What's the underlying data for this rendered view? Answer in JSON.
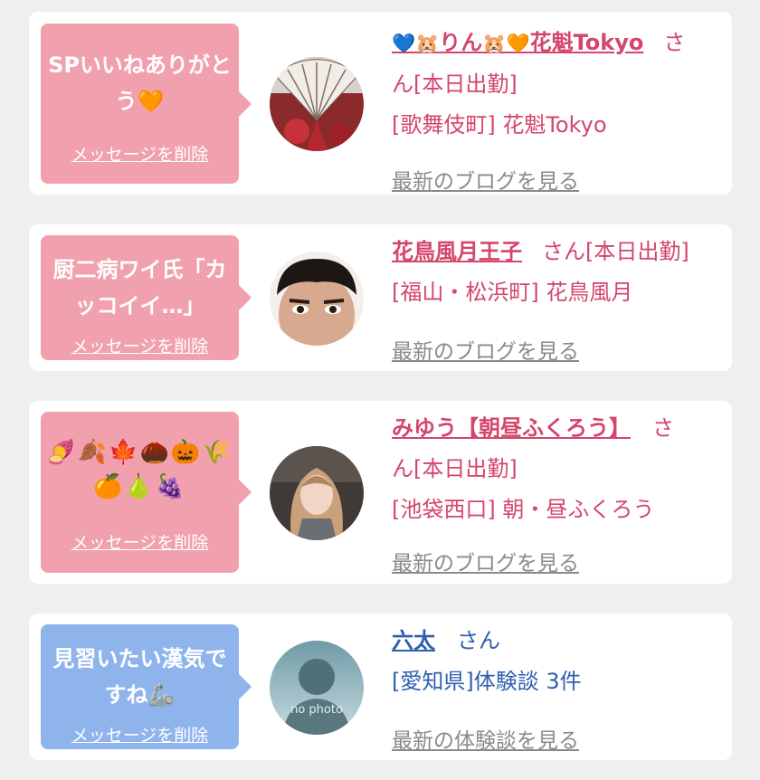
{
  "colors": {
    "background": "#efefef",
    "card": "#ffffff",
    "pink_bubble": "#f0a1ad",
    "blue_bubble": "#8fb4ec",
    "pink_text": "#d4466b",
    "blue_text": "#2f5fae",
    "link_gray": "#8a8a8a"
  },
  "delete_label": "メッセージを削除",
  "san": "さん",
  "cards": [
    {
      "message_line1": "SPいいねありがと",
      "message_line2": "う🧡",
      "name_prefix": "💙🐹",
      "name_main": "りん",
      "name_suffix": "🐹🧡",
      "name_shop": "花魁Tokyo",
      "work_status": "ん[本日出勤]",
      "san_head": "さ",
      "shop_info": "[歌舞伎町] 花魁Tokyo",
      "link": "最新のブログを見る",
      "avatar_icon": "folding-fan-photo"
    },
    {
      "message_line1": "厨二病ワイ氏「カ",
      "message_line2": "ッコイイ…」",
      "name": "花鳥風月王子",
      "work_status": "[本日出勤]",
      "shop_info": "[福山・松浜町] 花鳥風月",
      "link": "最新のブログを見る",
      "avatar_icon": "face-photo"
    },
    {
      "emoji_line1": "🍠🍂🍁🌰🎃🌾",
      "emoji_line2": "🍊🍐🍇",
      "name": "みゆう【朝昼ふくろう】",
      "san_head": "さ",
      "work_status": "ん[本日出勤]",
      "shop_info": "[池袋西口] 朝・昼ふくろう",
      "link": "最新のブログを見る",
      "avatar_icon": "girl-photo"
    },
    {
      "message_line1": "見習いたい漢気で",
      "message_line2": "すね🦾",
      "name": "六太",
      "shop_info": "[愛知県]体験談 3件",
      "link": "最新の体験談を見る",
      "avatar_icon": "no-photo-avatar",
      "avatar_text": "no photo"
    }
  ]
}
